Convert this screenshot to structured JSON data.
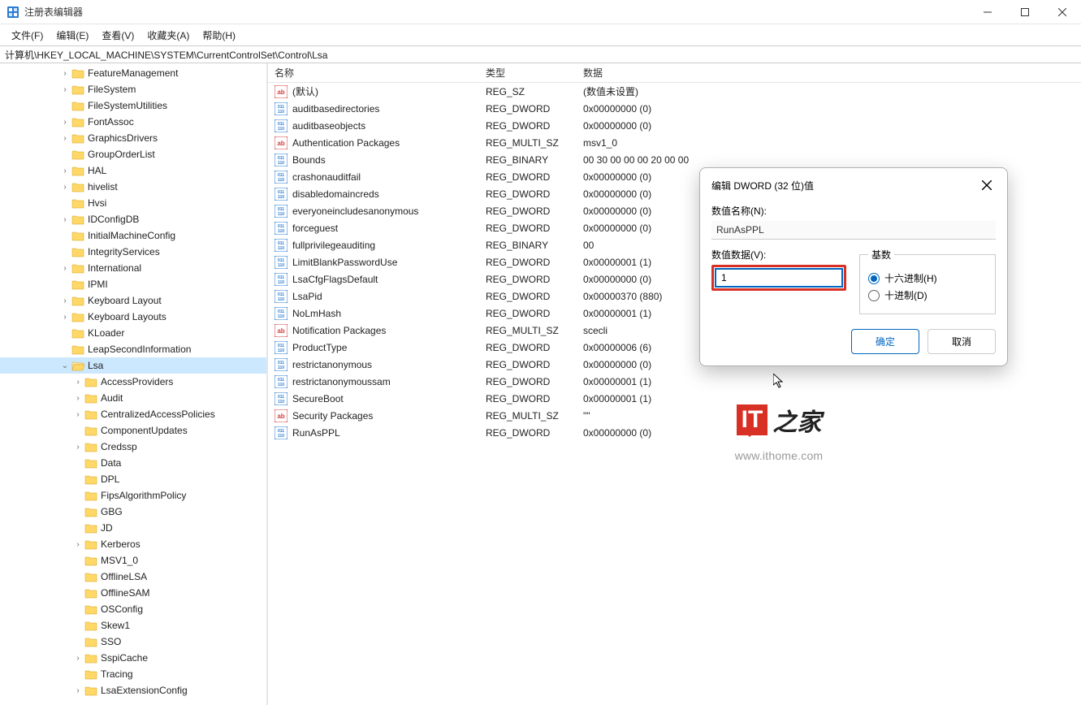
{
  "window": {
    "title": "注册表编辑器"
  },
  "menu": {
    "file": "文件(F)",
    "edit": "编辑(E)",
    "view": "查看(V)",
    "fav": "收藏夹(A)",
    "help": "帮助(H)"
  },
  "address": "计算机\\HKEY_LOCAL_MACHINE\\SYSTEM\\CurrentControlSet\\Control\\Lsa",
  "columns": {
    "name": "名称",
    "type": "类型",
    "data": "数据"
  },
  "tree": [
    {
      "indent": 4,
      "exp": ">",
      "label": "FeatureManagement"
    },
    {
      "indent": 4,
      "exp": ">",
      "label": "FileSystem"
    },
    {
      "indent": 4,
      "exp": "",
      "label": "FileSystemUtilities"
    },
    {
      "indent": 4,
      "exp": ">",
      "label": "FontAssoc"
    },
    {
      "indent": 4,
      "exp": ">",
      "label": "GraphicsDrivers"
    },
    {
      "indent": 4,
      "exp": "",
      "label": "GroupOrderList"
    },
    {
      "indent": 4,
      "exp": ">",
      "label": "HAL"
    },
    {
      "indent": 4,
      "exp": ">",
      "label": "hivelist"
    },
    {
      "indent": 4,
      "exp": "",
      "label": "Hvsi"
    },
    {
      "indent": 4,
      "exp": ">",
      "label": "IDConfigDB"
    },
    {
      "indent": 4,
      "exp": "",
      "label": "InitialMachineConfig"
    },
    {
      "indent": 4,
      "exp": "",
      "label": "IntegrityServices"
    },
    {
      "indent": 4,
      "exp": ">",
      "label": "International"
    },
    {
      "indent": 4,
      "exp": "",
      "label": "IPMI"
    },
    {
      "indent": 4,
      "exp": ">",
      "label": "Keyboard Layout"
    },
    {
      "indent": 4,
      "exp": ">",
      "label": "Keyboard Layouts"
    },
    {
      "indent": 4,
      "exp": "",
      "label": "KLoader"
    },
    {
      "indent": 4,
      "exp": "",
      "label": "LeapSecondInformation"
    },
    {
      "indent": 4,
      "exp": "v",
      "label": "Lsa",
      "selected": true,
      "open": true
    },
    {
      "indent": 5,
      "exp": ">",
      "label": "AccessProviders"
    },
    {
      "indent": 5,
      "exp": ">",
      "label": "Audit"
    },
    {
      "indent": 5,
      "exp": ">",
      "label": "CentralizedAccessPolicies"
    },
    {
      "indent": 5,
      "exp": "",
      "label": "ComponentUpdates"
    },
    {
      "indent": 5,
      "exp": ">",
      "label": "Credssp"
    },
    {
      "indent": 5,
      "exp": "",
      "label": "Data"
    },
    {
      "indent": 5,
      "exp": "",
      "label": "DPL"
    },
    {
      "indent": 5,
      "exp": "",
      "label": "FipsAlgorithmPolicy"
    },
    {
      "indent": 5,
      "exp": "",
      "label": "GBG"
    },
    {
      "indent": 5,
      "exp": "",
      "label": "JD"
    },
    {
      "indent": 5,
      "exp": ">",
      "label": "Kerberos"
    },
    {
      "indent": 5,
      "exp": "",
      "label": "MSV1_0"
    },
    {
      "indent": 5,
      "exp": "",
      "label": "OfflineLSA"
    },
    {
      "indent": 5,
      "exp": "",
      "label": "OfflineSAM"
    },
    {
      "indent": 5,
      "exp": "",
      "label": "OSConfig"
    },
    {
      "indent": 5,
      "exp": "",
      "label": "Skew1"
    },
    {
      "indent": 5,
      "exp": "",
      "label": "SSO"
    },
    {
      "indent": 5,
      "exp": ">",
      "label": "SspiCache"
    },
    {
      "indent": 5,
      "exp": "",
      "label": "Tracing"
    },
    {
      "indent": 5,
      "exp": ">",
      "label": "LsaExtensionConfig"
    }
  ],
  "values": [
    {
      "icon": "sz",
      "name": "(默认)",
      "type": "REG_SZ",
      "data": "(数值未设置)"
    },
    {
      "icon": "bin",
      "name": "auditbasedirectories",
      "type": "REG_DWORD",
      "data": "0x00000000 (0)"
    },
    {
      "icon": "bin",
      "name": "auditbaseobjects",
      "type": "REG_DWORD",
      "data": "0x00000000 (0)"
    },
    {
      "icon": "sz",
      "name": "Authentication Packages",
      "type": "REG_MULTI_SZ",
      "data": "msv1_0"
    },
    {
      "icon": "bin",
      "name": "Bounds",
      "type": "REG_BINARY",
      "data": "00 30 00 00 00 20 00 00"
    },
    {
      "icon": "bin",
      "name": "crashonauditfail",
      "type": "REG_DWORD",
      "data": "0x00000000 (0)"
    },
    {
      "icon": "bin",
      "name": "disabledomaincreds",
      "type": "REG_DWORD",
      "data": "0x00000000 (0)"
    },
    {
      "icon": "bin",
      "name": "everyoneincludesanonymous",
      "type": "REG_DWORD",
      "data": "0x00000000 (0)"
    },
    {
      "icon": "bin",
      "name": "forceguest",
      "type": "REG_DWORD",
      "data": "0x00000000 (0)"
    },
    {
      "icon": "bin",
      "name": "fullprivilegeauditing",
      "type": "REG_BINARY",
      "data": "00"
    },
    {
      "icon": "bin",
      "name": "LimitBlankPasswordUse",
      "type": "REG_DWORD",
      "data": "0x00000001 (1)"
    },
    {
      "icon": "bin",
      "name": "LsaCfgFlagsDefault",
      "type": "REG_DWORD",
      "data": "0x00000000 (0)"
    },
    {
      "icon": "bin",
      "name": "LsaPid",
      "type": "REG_DWORD",
      "data": "0x00000370 (880)"
    },
    {
      "icon": "bin",
      "name": "NoLmHash",
      "type": "REG_DWORD",
      "data": "0x00000001 (1)"
    },
    {
      "icon": "sz",
      "name": "Notification Packages",
      "type": "REG_MULTI_SZ",
      "data": "scecli"
    },
    {
      "icon": "bin",
      "name": "ProductType",
      "type": "REG_DWORD",
      "data": "0x00000006 (6)"
    },
    {
      "icon": "bin",
      "name": "restrictanonymous",
      "type": "REG_DWORD",
      "data": "0x00000000 (0)"
    },
    {
      "icon": "bin",
      "name": "restrictanonymoussam",
      "type": "REG_DWORD",
      "data": "0x00000001 (1)"
    },
    {
      "icon": "bin",
      "name": "SecureBoot",
      "type": "REG_DWORD",
      "data": "0x00000001 (1)"
    },
    {
      "icon": "sz",
      "name": "Security Packages",
      "type": "REG_MULTI_SZ",
      "data": "\"\""
    },
    {
      "icon": "bin",
      "name": "RunAsPPL",
      "type": "REG_DWORD",
      "data": "0x00000000 (0)"
    }
  ],
  "dialog": {
    "title": "编辑 DWORD (32 位)值",
    "name_label": "数值名称(N):",
    "name_value": "RunAsPPL",
    "data_label": "数值数据(V):",
    "data_value": "1",
    "base_legend": "基数",
    "hex": "十六进制(H)",
    "dec": "十进制(D)",
    "ok": "确定",
    "cancel": "取消"
  },
  "watermark": {
    "logo_it": "IT",
    "logo_cn": "之家",
    "url": "www.ithome.com"
  }
}
